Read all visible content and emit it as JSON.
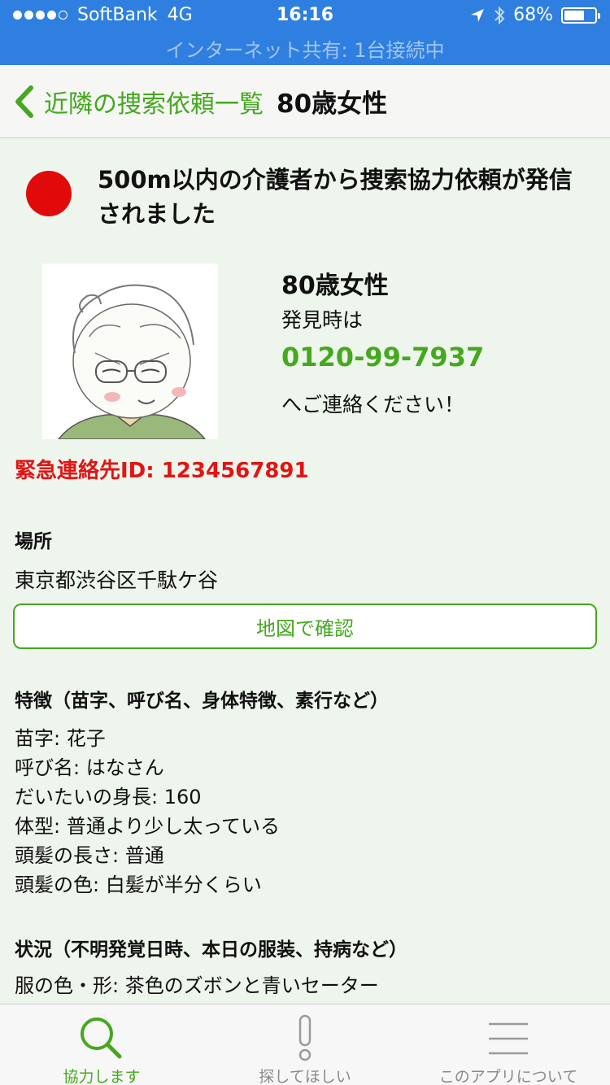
{
  "status_bar": {
    "carrier": "SoftBank",
    "network": "4G",
    "time": "16:16",
    "battery": "68%",
    "battery_level": 0.68,
    "hotspot": "インターネット共有: 1台接続中"
  },
  "nav": {
    "back_label": "近隣の捜索依頼一覧",
    "title": "80歳女性"
  },
  "alert": {
    "message": "500m以内の介護者から捜索協力依頼が発信されました",
    "color": "#e10a0a"
  },
  "person": {
    "name": "80歳女性",
    "found_label": "発見時は",
    "phone": "0120-99-7937",
    "contact_label": "へご連絡ください！"
  },
  "emergency": {
    "label": "緊急連絡先ID: 1234567891"
  },
  "location": {
    "heading": "場所",
    "value": "東京都渋谷区千駄ケ谷",
    "map_button": "地図で確認"
  },
  "features": {
    "heading": "特徴（苗字、呼び名、身体特徴、素行など）",
    "lines": [
      "苗字: 花子",
      "呼び名: はなさん",
      "だいたいの身長: 160",
      "体型: 普通より少し太っている",
      "頭髪の長さ: 普通",
      "頭髪の色: 白髪が半分くらい"
    ]
  },
  "situation": {
    "heading": "状況（不明発覚日時、本日の服装、持病など）",
    "lines": [
      "服の色・形: 茶色のズボンと青いセーター"
    ]
  },
  "tabs": [
    {
      "label": "協力します",
      "icon": "search-icon",
      "active": true
    },
    {
      "label": "探してほしい",
      "icon": "exclamation-icon",
      "active": false
    },
    {
      "label": "このアプリについて",
      "icon": "menu-icon",
      "active": false
    }
  ],
  "colors": {
    "accent": "#45a81f",
    "status_bar": "#2f7fe0",
    "emergency": "#e01515"
  }
}
